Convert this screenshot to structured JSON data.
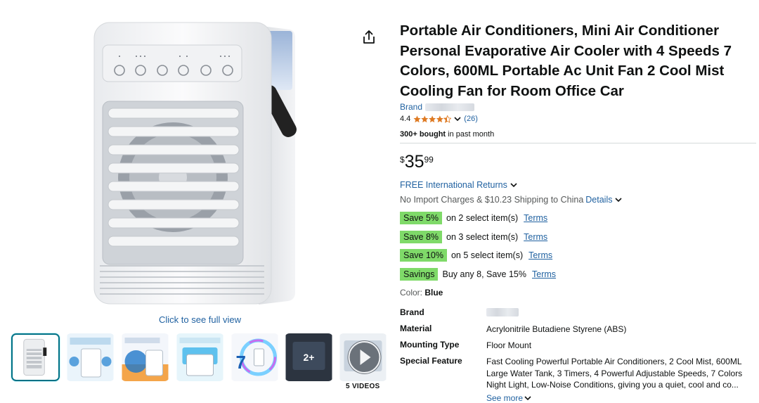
{
  "product": {
    "title": "Portable Air Conditioners, Mini Air Conditioner Personal Evaporative Air Cooler with 4 Speeds 7 Colors, 600ML Portable Ac Unit Fan 2 Cool Mist Cooling Fan for Room Office Car",
    "brand_label": "Brand",
    "rating": "4.4",
    "rating_value": 4.4,
    "review_count": "(26)",
    "bought_bold": "300+ bought",
    "bought_rest": " in past month"
  },
  "price": {
    "symbol": "$",
    "whole": "35",
    "fraction": "99"
  },
  "shipping": {
    "returns": "FREE International Returns",
    "import_text": "No Import Charges & $10.23 Shipping to China",
    "details": "Details"
  },
  "promos": [
    {
      "badge": "Save 5%",
      "text": "on 2 select item(s)",
      "terms": "Terms"
    },
    {
      "badge": "Save 8%",
      "text": "on 3 select item(s)",
      "terms": "Terms"
    },
    {
      "badge": "Save 10%",
      "text": "on 5 select item(s)",
      "terms": "Terms"
    },
    {
      "badge": "Savings",
      "text": "Buy any 8, Save 15%",
      "terms": "Terms"
    }
  ],
  "color": {
    "label": "Color: ",
    "value": "Blue"
  },
  "specs": [
    {
      "key": "Brand",
      "value": ""
    },
    {
      "key": "Material",
      "value": "Acrylonitrile Butadiene Styrene (ABS)"
    },
    {
      "key": "Mounting Type",
      "value": "Floor Mount"
    },
    {
      "key": "Special Feature",
      "value": "Fast Cooling Powerful Portable Air Conditioners, 2 Cool Mist, 600ML Large Water Tank, 3 Timers, 4 Powerful Adjustable Speeds, 7 Colors Night Light, Low-Noise Conditions, giving you a quiet, cool and co..."
    }
  ],
  "see_more": "See more",
  "gallery": {
    "full_view": "Click to see full view",
    "more_count": "2+",
    "videos_label": "5 VIDEOS"
  },
  "colors": {
    "link": "#2162a1",
    "badge": "#7fda69",
    "star": "#de7921",
    "thumb_active": "#007185"
  }
}
